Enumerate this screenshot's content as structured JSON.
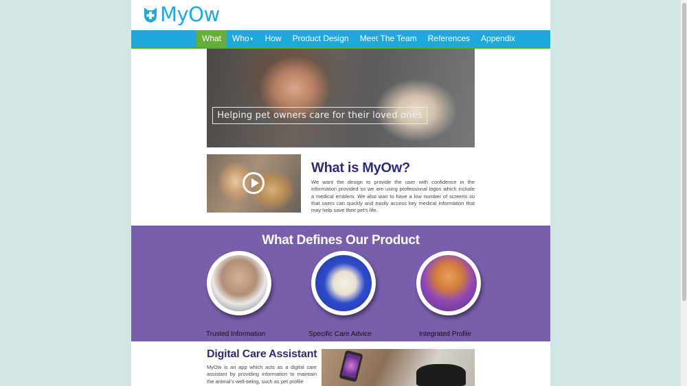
{
  "brand": {
    "logo_text": "MyOw",
    "logo_icon": "cat-shield-cross-icon",
    "color": "#1fa8dc"
  },
  "nav": {
    "items": [
      {
        "label": "What",
        "active": true
      },
      {
        "label": "Who",
        "has_dropdown": true
      },
      {
        "label": "How"
      },
      {
        "label": "Product Design"
      },
      {
        "label": "Meet The Team"
      },
      {
        "label": "References"
      },
      {
        "label": "Appendix"
      }
    ],
    "background": "#1fa8dc",
    "active_color": "#66ad3a"
  },
  "hero": {
    "caption": "Helping pet owners care for their loved ones"
  },
  "what": {
    "title": "What is MyOw?",
    "text": "We want the design to provide the user with confidence in the information provided so we are using professional logos which include a medical emblem. We also wan to have a low number of screens so that users can quickly and easily access key medical information that may help save their pet's life."
  },
  "product": {
    "title": "What Defines Our Product",
    "background": "#795eab",
    "features": [
      {
        "label": "Trusted Information"
      },
      {
        "label": "Specific Care Advice"
      },
      {
        "label": "Integrated Profile"
      }
    ]
  },
  "dca": {
    "title": "Digital Care Assistant",
    "text": "MyOw is an app which acts as a digital care assistant by providing information to maintain the animal's well-being, such as pet profile"
  }
}
